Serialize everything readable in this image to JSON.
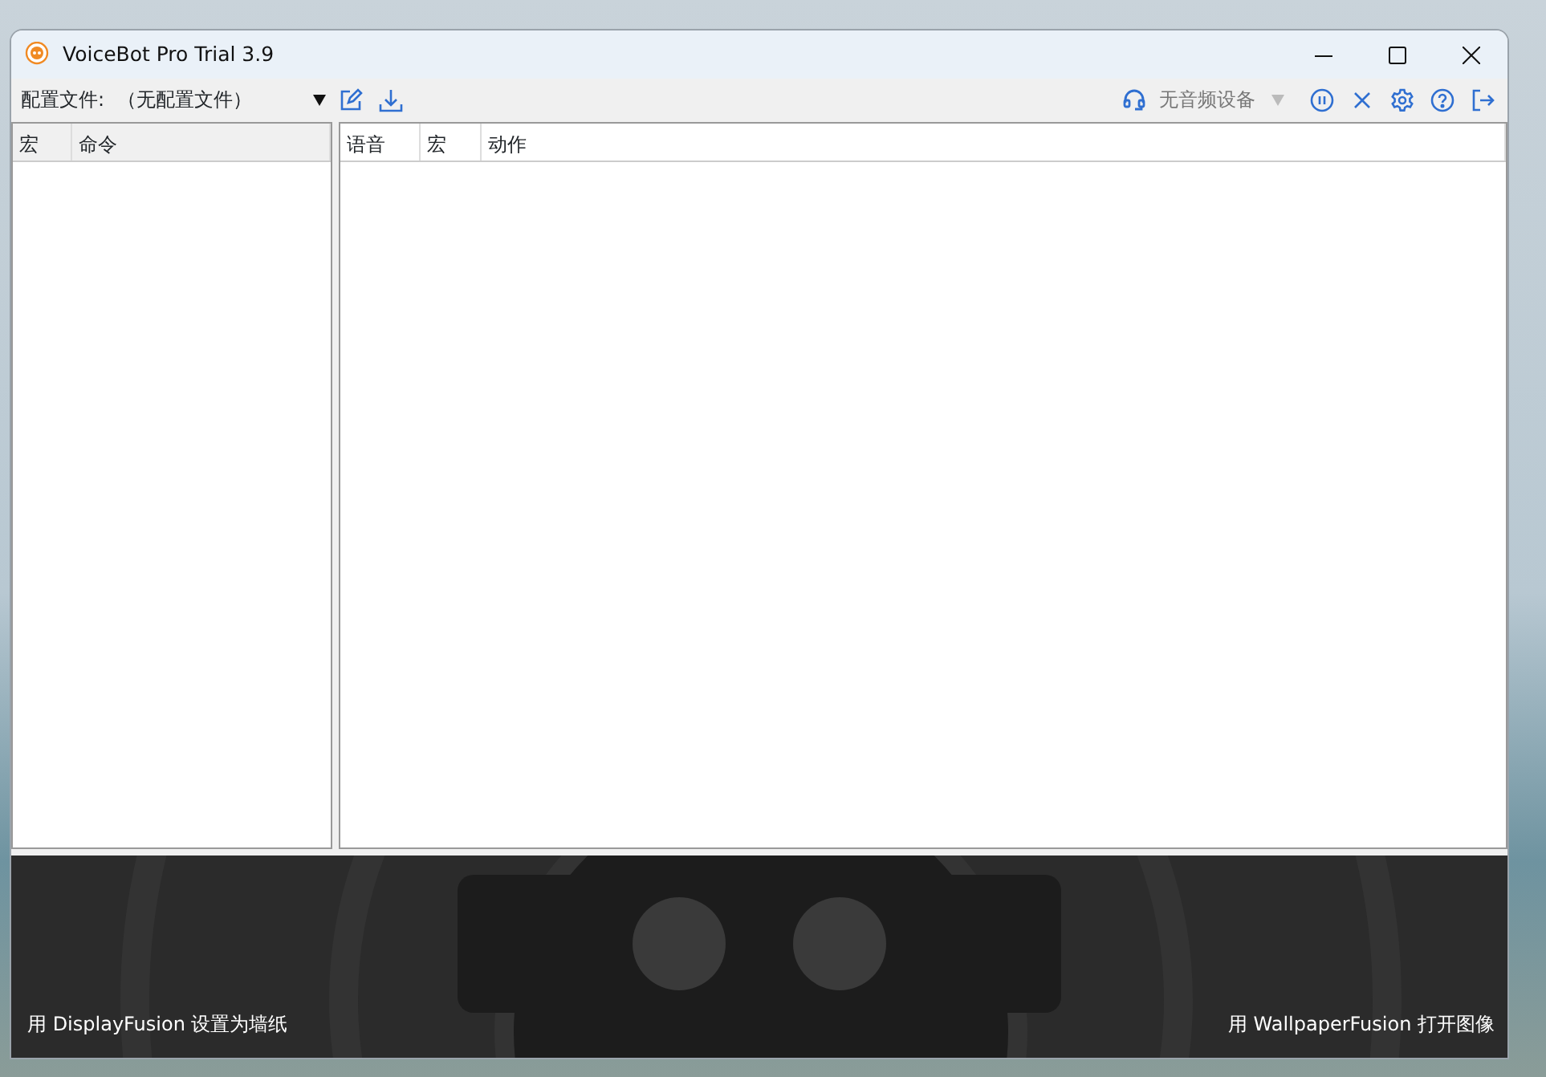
{
  "window": {
    "title": "VoiceBot Pro Trial 3.9"
  },
  "toolbar": {
    "profile_label": "配置文件:",
    "profile_value": "（无配置文件）",
    "audio_device": "无音频设备",
    "audio_device_disabled": true
  },
  "left_table": {
    "columns": [
      "宏",
      "命令"
    ]
  },
  "right_table": {
    "columns": [
      "语音",
      "宏",
      "动作"
    ]
  },
  "banner": {
    "left_link": "用 DisplayFusion 设置为墙纸",
    "right_link": "用 WallpaperFusion 打开图像"
  }
}
